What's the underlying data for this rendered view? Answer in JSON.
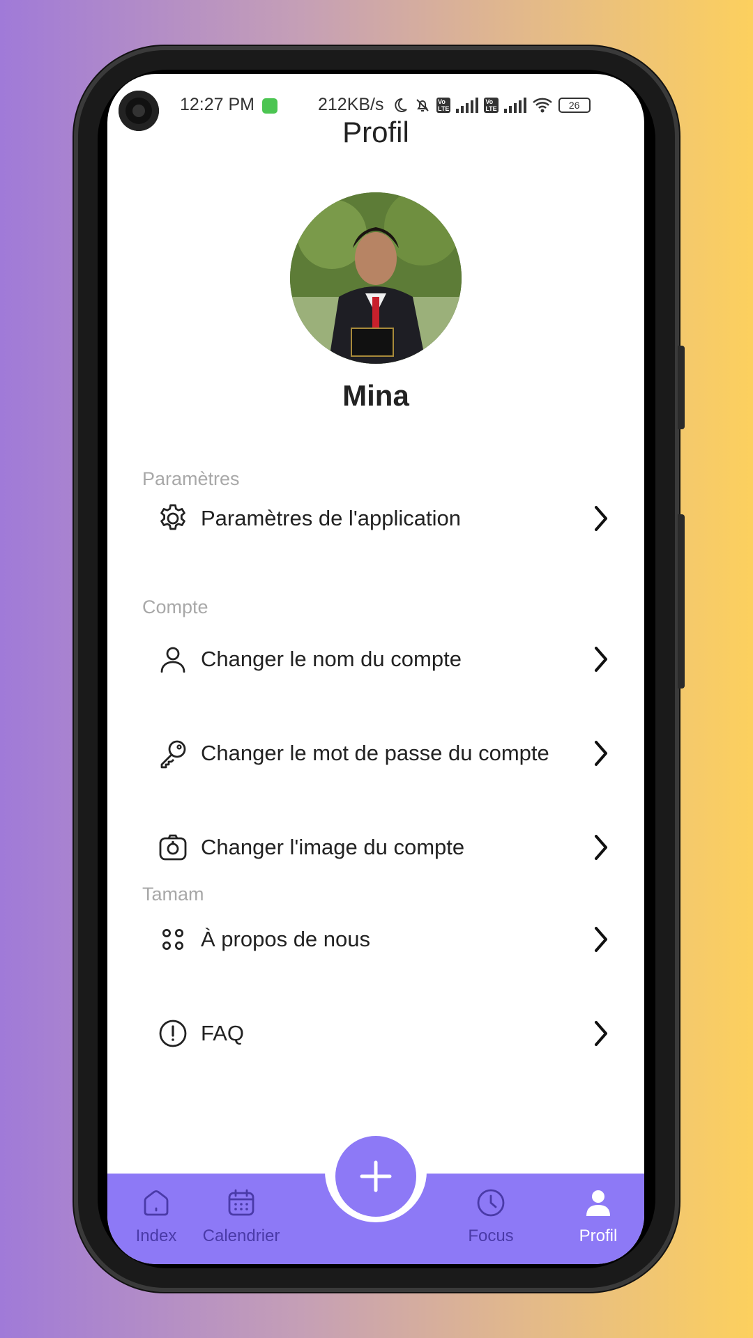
{
  "status_bar": {
    "time": "12:27 PM",
    "net_speed": "212KB/s",
    "battery": "26"
  },
  "page": {
    "title": "Profil",
    "user_name": "Mina"
  },
  "sections": [
    {
      "label": "Paramètres",
      "items": [
        {
          "label": "Paramètres de l'application",
          "icon": "gear-icon"
        }
      ]
    },
    {
      "label": "Compte",
      "items": [
        {
          "label": "Changer le nom du compte",
          "icon": "user-icon"
        },
        {
          "label": "Changer le mot de passe du compte",
          "icon": "key-icon"
        },
        {
          "label": "Changer l'image du compte",
          "icon": "camera-icon"
        }
      ]
    },
    {
      "label": "Tamam",
      "items": [
        {
          "label": "À propos de nous",
          "icon": "dots-grid-icon"
        },
        {
          "label": "FAQ",
          "icon": "info-circle-icon"
        }
      ]
    }
  ],
  "bottom_nav": {
    "items": [
      {
        "label": "Index",
        "icon": "home-icon"
      },
      {
        "label": "Calendrier",
        "icon": "calendar-icon"
      },
      {
        "label": "Focus",
        "icon": "clock-icon"
      },
      {
        "label": "Profil",
        "icon": "user-filled-icon",
        "active": true
      }
    ],
    "fab_icon": "plus-icon"
  },
  "colors": {
    "accent": "#8d79f6",
    "section_label": "#a8a8a8",
    "text": "#222222"
  }
}
